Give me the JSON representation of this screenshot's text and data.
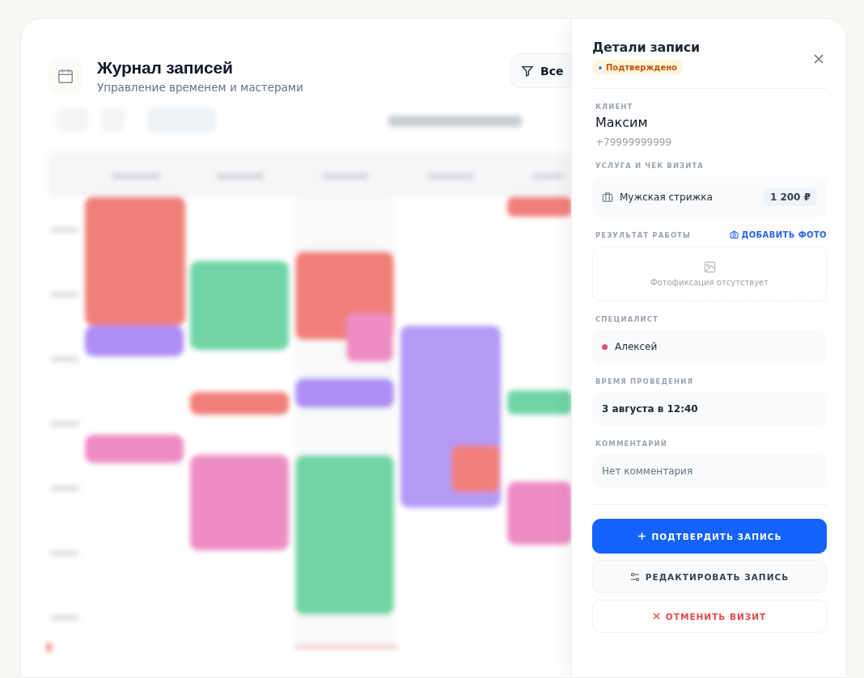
{
  "header": {
    "title": "Журнал записей",
    "subtitle": "Управление временем и мастерами",
    "filter_button": "Все"
  },
  "details": {
    "title": "Детали записи",
    "status": {
      "label": "Подтверждено"
    },
    "client": {
      "label": "КЛИЕНТ",
      "name": "Максим",
      "phone": "+79999999999"
    },
    "service": {
      "label": "УСЛУГА И ЧЕК ВИЗИТА",
      "name": "Мужская стрижка",
      "price": "1 200 ₽"
    },
    "result": {
      "label": "РЕЗУЛЬТАТ РАБОТЫ",
      "link": "ДОБАВИТЬ ФОТО",
      "placeholder": "Фотофиксация отсутствует"
    },
    "specialist": {
      "label": "СПЕЦИАЛИСТ",
      "name": "Алексей",
      "color": "#e8488a"
    },
    "time": {
      "label": "ВРЕМЯ ПРОВЕДЕНИЯ",
      "value": "3 августа в 12:40"
    },
    "comment": {
      "label": "КОММЕНТАРИЙ",
      "value": "Нет комментария"
    },
    "buttons": [
      {
        "label": "ПОДТВЕРДИТЬ ЗАПИСЬ",
        "kind": "primary"
      },
      {
        "label": "РЕДАКТИРОВАТЬ ЗАПИСЬ",
        "kind": "secondary"
      },
      {
        "label": "ОТМЕНИТЬ ВИЗИТ",
        "kind": "danger"
      }
    ]
  }
}
